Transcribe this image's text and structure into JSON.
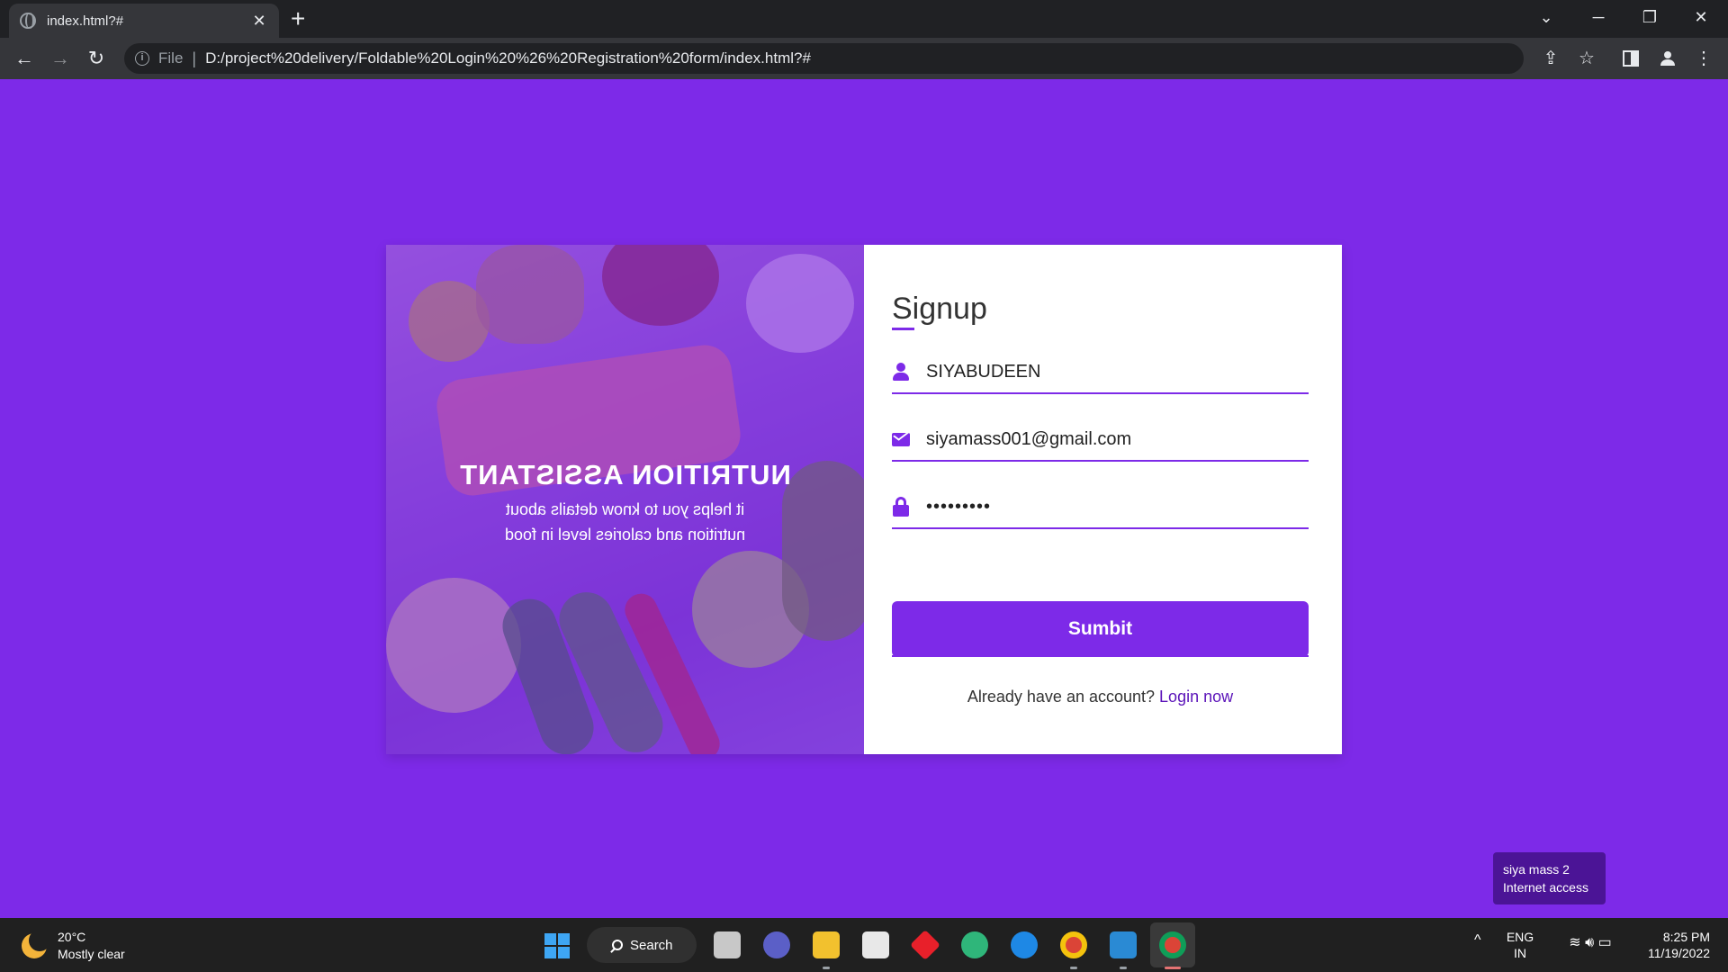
{
  "browser": {
    "tab_title": "index.html?#",
    "tab_close": "✕",
    "new_tab": "+",
    "window_controls": {
      "dropdown": "⌄",
      "minimize": "─",
      "restore": "❐",
      "close": "✕"
    },
    "address": {
      "scheme_label": "File",
      "separator": "|",
      "url": "D:/project%20delivery/Foldable%20Login%20%26%20Registration%20form/index.html?#"
    },
    "icons": [
      "back-arrow-icon",
      "forward-arrow-icon",
      "reload-icon",
      "info-icon",
      "share-icon",
      "star-icon",
      "side-panel-icon",
      "profile-icon",
      "menu-icon"
    ]
  },
  "cover": {
    "title": "NUTRITION ASSISTANT",
    "subtitle_line1": "it helps you to know details about",
    "subtitle_line2": "nutrition and calories level in food",
    "mirrored": true
  },
  "form": {
    "title": "Signup",
    "name_value": "SIYABUDEEN",
    "email_value": "siyamass001@gmail.com",
    "password_value": "•••••••••",
    "submit_label": "Sumbit",
    "login_prompt": "Already have an account?",
    "login_link": "Login now"
  },
  "tooltip": {
    "line1": "siya mass 2",
    "line2": "Internet access"
  },
  "taskbar": {
    "weather_temp": "20°C",
    "weather_desc": "Mostly clear",
    "search_label": "Search",
    "lang_line1": "ENG",
    "lang_line2": "IN",
    "time": "8:25 PM",
    "date": "11/19/2022",
    "tray_chevron": "^"
  },
  "colors": {
    "accent": "#7d2ae8",
    "page_bg": "#7d2ae8",
    "link": "#5b13b9"
  }
}
